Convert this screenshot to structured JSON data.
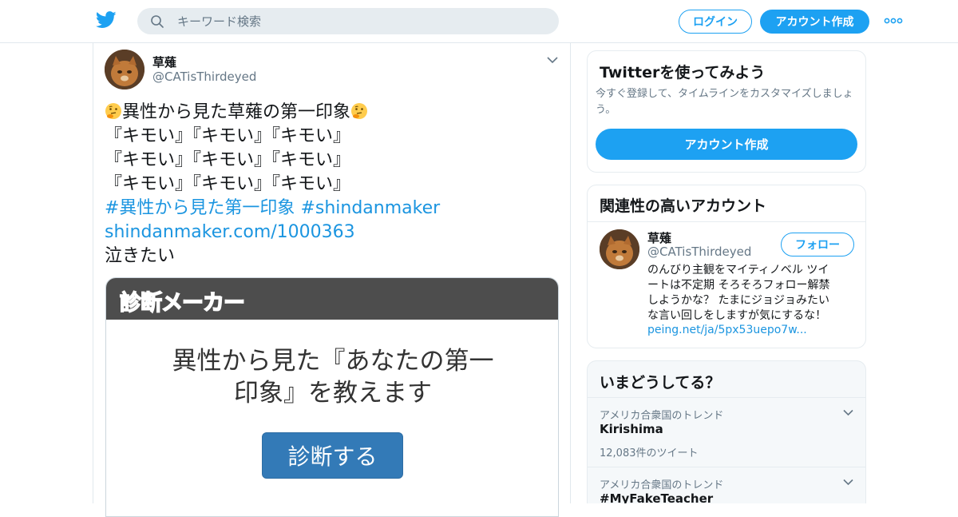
{
  "header": {
    "search_placeholder": "キーワード検索",
    "login_label": "ログイン",
    "signup_label": "アカウント作成"
  },
  "tweet": {
    "author_name": "草薙",
    "author_handle": "@CATisThirdeyed",
    "line1": "異性から見た草薙の第一印象",
    "line2": "『キモい』『キモい』『キモい』",
    "line3": "『キモい』『キモい』『キモい』",
    "line4": "『キモい』『キモい』『キモい』",
    "hashtag1": "#異性から見た第一印象",
    "hashtag2": "#shindanmaker",
    "url": "shindanmaker.com/1000363",
    "line5": "泣きたい",
    "card": {
      "logo": "診断メーカー",
      "title_line1": "異性から見た『あなたの第一",
      "title_line2": "印象』を教えます",
      "button_label": "診断する"
    }
  },
  "sidebar": {
    "signup_box": {
      "title": "Twitterを使ってみよう",
      "desc_line1": "今すぐ登録して、タイムラインをカスタマイズしましょ",
      "desc_line2": "う。",
      "button_label": "アカウント作成"
    },
    "related": {
      "title": "関連性の高いアカウント",
      "name": "草薙",
      "handle": "@CATisThirdeyed",
      "follow_label": "フォロー",
      "bio_line1": "のんびり主観をマイティノベル ツイ",
      "bio_line2": "ートは不定期 そろそろフォロー解禁",
      "bio_line3": "しようかな？ たまにジョジョみたい",
      "bio_line4": "な言い回しをしますが気にするな！",
      "link": "peing.net/ja/5px53uepo7w..."
    },
    "trends": {
      "title": "いまどうしてる？",
      "items": [
        {
          "context": "アメリカ合衆国のトレンド",
          "name": "Kirishima",
          "count": "12,083件のツイート"
        },
        {
          "context": "アメリカ合衆国のトレンド",
          "name": "#MyFakeTeacher"
        }
      ]
    }
  },
  "colors": {
    "twitter_blue": "#1da1f2",
    "link_blue": "#1b95e0",
    "card_button": "#337ab7"
  },
  "icons": [
    "twitter-bird-logo",
    "search-icon",
    "more-dots-icon",
    "chevron-down-icon",
    "thinking-face-emoji"
  ]
}
